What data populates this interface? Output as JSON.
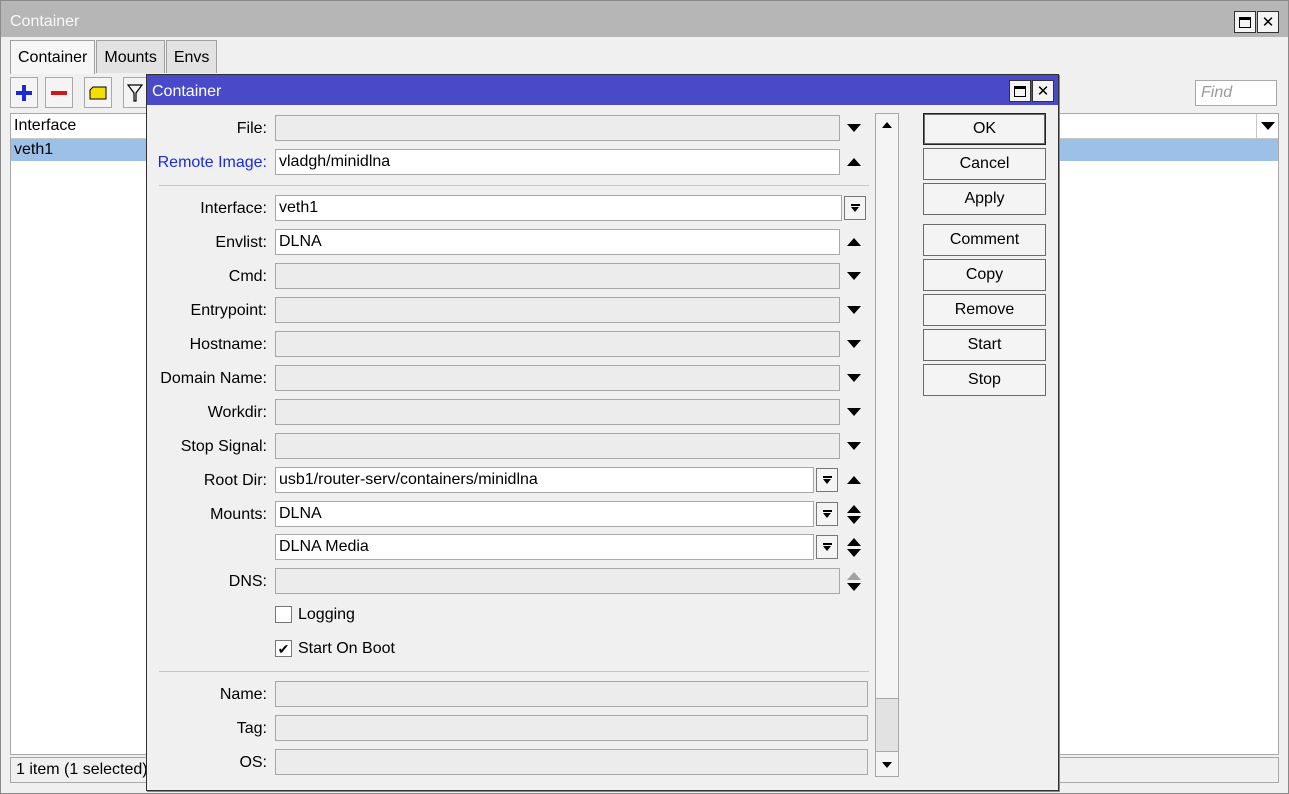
{
  "outer": {
    "title": "Container",
    "tabs": [
      "Container",
      "Mounts",
      "Envs"
    ],
    "find_placeholder": "Find",
    "column_header": "Interface",
    "rows": [
      "veth1"
    ],
    "status": "1 item (1 selected)"
  },
  "dialog": {
    "title": "Container",
    "fields": {
      "file": {
        "label": "File:",
        "value": ""
      },
      "remote_image": {
        "label": "Remote Image:",
        "value": "vladgh/minidlna"
      },
      "interface": {
        "label": "Interface:",
        "value": "veth1"
      },
      "envlist": {
        "label": "Envlist:",
        "value": "DLNA"
      },
      "cmd": {
        "label": "Cmd:",
        "value": ""
      },
      "entrypoint": {
        "label": "Entrypoint:",
        "value": ""
      },
      "hostname": {
        "label": "Hostname:",
        "value": ""
      },
      "domain_name": {
        "label": "Domain Name:",
        "value": ""
      },
      "workdir": {
        "label": "Workdir:",
        "value": ""
      },
      "stop_signal": {
        "label": "Stop Signal:",
        "value": ""
      },
      "root_dir": {
        "label": "Root Dir:",
        "value": "usb1/router-serv/containers/minidlna"
      },
      "mounts": {
        "label": "Mounts:",
        "values": [
          "DLNA",
          "DLNA Media"
        ]
      },
      "dns": {
        "label": "DNS:",
        "value": ""
      },
      "name": {
        "label": "Name:",
        "value": ""
      },
      "tag": {
        "label": "Tag:",
        "value": ""
      },
      "os": {
        "label": "OS:",
        "value": ""
      }
    },
    "checkboxes": {
      "logging": {
        "label": "Logging",
        "checked": false
      },
      "start_on_boot": {
        "label": "Start On Boot",
        "checked": true,
        "mark": "✔"
      }
    },
    "buttons": [
      "OK",
      "Cancel",
      "Apply",
      "Comment",
      "Copy",
      "Remove",
      "Start",
      "Stop"
    ]
  },
  "colors": {
    "dialog_title_bg": "#4a4ac8",
    "selected_row": "#9cc0e6",
    "link_label": "#1a2ad8"
  }
}
